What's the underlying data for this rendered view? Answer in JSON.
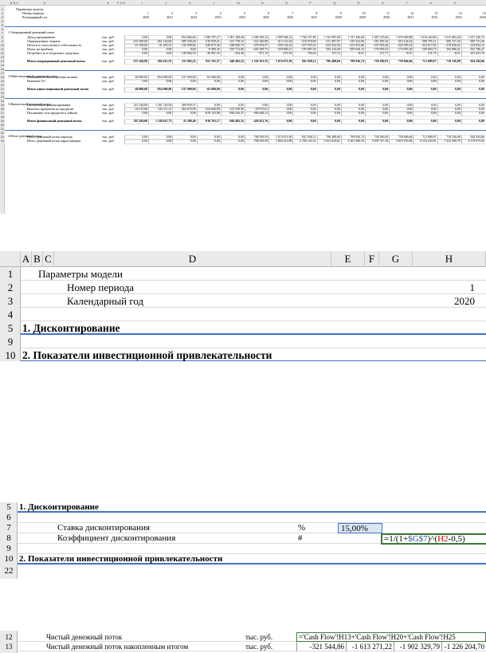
{
  "panel1": {
    "columns": [
      "A",
      "B",
      "C",
      "D",
      "E",
      "F",
      "G",
      "H",
      "I",
      "J",
      "K",
      "L",
      "M",
      "N",
      "O",
      "P",
      "Q",
      "R",
      "S",
      "T",
      "U",
      "V"
    ],
    "rows": [
      "1",
      "2",
      "3",
      "4",
      "5",
      "6",
      "7",
      "8",
      "9",
      "10",
      "11",
      "12",
      "13",
      "14",
      "15",
      "16",
      "17",
      "18",
      "19",
      "20",
      "21",
      "22",
      "23",
      "24",
      "25",
      "26",
      "27",
      "28",
      "29",
      "30",
      "31",
      "32",
      "33",
      "34"
    ],
    "header": {
      "title": "Параметры модели",
      "period_label": "Номер периода",
      "year_label": "Календарный год",
      "periods": [
        "1",
        "2",
        "3",
        "4",
        "5",
        "6",
        "7",
        "8",
        "9",
        "10",
        "11",
        "12",
        "13",
        "14",
        "15"
      ],
      "years": [
        "2020",
        "2021",
        "2022",
        "2023",
        "2024",
        "2025",
        "2026",
        "2027",
        "2028",
        "2029",
        "2030",
        "2031",
        "2032",
        "2033",
        "2034"
      ]
    },
    "sections": {
      "operating": "1   Операционный денежный поток",
      "investing": "2   Инвестиционный денежный поток",
      "financing": "3   Финансовый денежный поток",
      "total": "4   Итого денежный поток"
    },
    "unit": "тыс. руб.",
    "operating_rows": [
      {
        "label": "Доход предприятия",
        "values": [
          "0,00",
          "0,00",
          "854 884,84",
          "1 588 787,27",
          "1 901 180,48",
          "2 286 583,32",
          "2 099 948,12",
          "1 784 197,80",
          "1 723 995,00",
          "1 727 436,68",
          "1 687 219,60",
          "1 670 690,88",
          "1 610 443,80",
          "1 613 883,28",
          "1 617 328,70"
        ]
      },
      {
        "label": "Операционные затраты",
        "values": [
          "-253 500,00",
          "-261 120,00",
          "-389 356,26",
          "-310 839,21",
          "-311 738,33",
          "-314 436,08",
          "-313 125,34",
          "-310 918,96",
          "-311 497,97",
          "-310 322,06",
          "-310 100,34",
          "-310 124,63",
          "-309 795,11",
          "-309 727,20",
          "-309 751,26"
        ]
      },
      {
        "label": "Налоги и отчисления в себестоимость",
        "values": [
          "-21 928,00",
          "-31 495,55",
          "-143 058,84",
          "-240 675,36",
          "-248 840,79",
          "-270 674,97",
          "-258 124,22",
          "-237 935,03",
          "-233 924,50",
          "-231 852,66",
          "-227 929,46",
          "-225 929,14",
          "-222 017,83",
          "-219 026,02",
          "-218 834,13"
        ]
      },
      {
        "label": "Налог на прибыль",
        "values": [
          "0,00",
          "0,00",
          "0,00",
          "-9 369,35",
          "-195 772,80",
          "-283 399,73",
          "-259 800,27",
          "-195 097,35",
          "-184 134,49",
          "-185 036,15",
          "-176 059,52",
          "-174 905,38",
          "-169 904,75",
          "-164 886,41",
          "-163 786,27"
        ]
      },
      {
        "label": "Потребность в оборотных средствах",
        "values": [
          "0,00",
          "0,00",
          "-130 864,35",
          "-30 967,35",
          "-254,36",
          "-971,19",
          "-472,59",
          "765,45",
          "151,72",
          "-8,67",
          "151,77",
          "-8,67",
          "151,78",
          "-8,67",
          "201 441,70"
        ]
      },
      {
        "label": "Итого операционный денежный поток",
        "values": [
          "-257 428,00",
          "-292 615,55",
          "231 003,33",
          "955 765,57",
          "648 495,52",
          "1 218 101,35",
          "1 074 673,30",
          "841 928,12",
          "796 488,60",
          "799 936,74",
          "758 180,83",
          "759 606,66",
          "713 889,97",
          "719 336,98",
          "924 394,86"
        ]
      }
    ],
    "investing_rows": [
      {
        "label": "Вложения во внеоборотные активы",
        "values": [
          "-40 000,00",
          "-854 000,00",
          "-237 000,00",
          "-65 000,00",
          "0,00",
          "0,00",
          "0,00",
          "0,00",
          "0,00",
          "0,00",
          "0,00",
          "0,00",
          "0,00",
          "0,00",
          "0,00"
        ]
      },
      {
        "label": "Выбытие ОС",
        "values": [
          "0,00",
          "0,00",
          "0,00",
          "0,00",
          "0,00",
          "0,00",
          "0,00",
          "0,00",
          "0,00",
          "0,00",
          "0,00",
          "0,00",
          "0,00",
          "0,00",
          "0,00"
        ]
      },
      {
        "label": "Итого инвестиционный денежный поток",
        "values": [
          "-40 000,00",
          "-854 000,00",
          "-237 000,00",
          "-65 000,00",
          "0,00",
          "0,00",
          "0,00",
          "0,00",
          "0,00",
          "0,00",
          "0,00",
          "0,00",
          "0,00",
          "0,00",
          "0,00"
        ]
      }
    ],
    "financing_rows": [
      {
        "label": "Поступление финансирования",
        "values": [
          "321 544,86",
          "1 291 726,94",
          "289 059,37",
          "0,00",
          "0,00",
          "0,00",
          "0,00",
          "0,00",
          "0,00",
          "0,00",
          "0,00",
          "0,00",
          "0,00",
          "0,00",
          "0,00"
        ]
      },
      {
        "label": "Выплата процентов по кредитам",
        "values": [
          "-24 115,86",
          "-143 111,21",
          "-263 670,08",
          "-254 640,09",
          "-121 930,96",
          "-29 973,61",
          "0,00",
          "0,00",
          "0,00",
          "0,00",
          "0,00",
          "0,00",
          "0,00",
          "0,00",
          "0,00"
        ]
      },
      {
        "label": "Погашение тела кредитов и займов",
        "values": [
          "0,00",
          "0,00",
          "0,00",
          "-676 125,08",
          "-826 556,37",
          "-399 648,12",
          "0,00",
          "0,00",
          "0,00",
          "0,00",
          "0,00",
          "0,00",
          "0,00",
          "0,00",
          "0,00"
        ]
      },
      {
        "label": "Итого финансовый денежный поток",
        "values": [
          "297 429,00",
          "1 148 615,73",
          "25 388,49",
          "-910 765,17",
          "-948 485,32",
          "-429 621,76",
          "0,00",
          "0,00",
          "0,00",
          "0,00",
          "0,00",
          "0,00",
          "0,00",
          "0,00",
          "0,00"
        ]
      }
    ],
    "total_rows": [
      {
        "label": "Итого денежный поток периода",
        "values": [
          "0,00",
          "0,00",
          "0,00",
          "0,00",
          "0,00",
          "788 539,59",
          "1 074 673,30",
          "841 928,12",
          "796 488,60",
          "799 936,74",
          "758 180,83",
          "759 606,66",
          "713 889,97",
          "719 336,98",
          "924 394,86"
        ]
      },
      {
        "label": "Итого денежный поток нарастающим",
        "values": [
          "0,00",
          "0,00",
          "0,00",
          "0,00",
          "0,00",
          "788 539,59",
          "1 863 212,89",
          "2 705 141,01",
          "3 501 629,61",
          "4 301 566,35",
          "5 059 747,18",
          "5 819 353,84",
          "6 533 243,81",
          "7 252 580,79",
          "8 176 975,65"
        ]
      }
    ]
  },
  "panel2": {
    "columns": [
      "A",
      "B",
      "C",
      "D",
      "E",
      "F",
      "G",
      "H"
    ],
    "rows": [
      "1",
      "2",
      "3",
      "4",
      "5",
      "9",
      "10",
      "22"
    ],
    "title": "Параметры модели",
    "period_label": "Номер периода",
    "period_value": "1",
    "year_label": "Календарный год",
    "year_value": "2020",
    "section1": "1.   Дисконтирование",
    "section2": "2.   Показатели инвестиционной привлекательности"
  },
  "panel3": {
    "rows": [
      "5",
      "6",
      "7",
      "8",
      "9",
      "10",
      "22"
    ],
    "section1": "1.   Дисконтирование",
    "rate_label": "Ставка дисконтирования",
    "rate_unit": "%",
    "rate_value": "15,00%",
    "factor_label": "Коэффициент дисконтирования",
    "factor_unit": "#",
    "formula_prefix": "=1/(1+",
    "formula_ref1": "$G$7",
    "formula_mid": ")^(",
    "formula_ref2": "H2",
    "formula_suffix": "-0,5)",
    "section2": "2.   Показатели инвестиционной привлекательности"
  },
  "panel4": {
    "rows": [
      "12",
      "13"
    ],
    "row12_label": "Чистый денежный поток",
    "row13_label": "Чистый денежный поток накопленным итогом",
    "unit": "тыс. руб.",
    "formula": "='Cash Flow'!H13+'Cash Flow'!H20+'Cash Flow'!H25",
    "values": [
      "-321 544,86",
      "-1 613 271,22",
      "-1 902 329,79",
      "-1 226 204,70"
    ]
  }
}
